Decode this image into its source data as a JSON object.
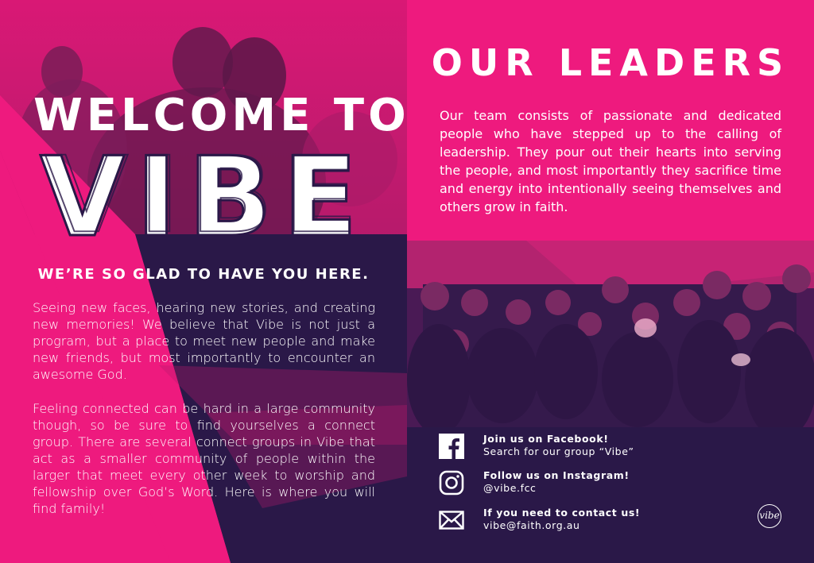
{
  "left": {
    "welcome": "WELCOME TO",
    "vibe": "VIBE",
    "subhead": "WE’RE SO GLAD TO HAVE YOU HERE.",
    "paragraph1": "Seeing new faces, hearing new stories, and creating new memories! We believe that Vibe is not just a program, but a place to meet new people and make new friends, but most importantly to encounter an awesome God.",
    "paragraph2": "Feeling connected can be hard in a large community though, so be sure to find yourselves a connect group. There are several connect groups in Vibe that act as a smaller community of people within the larger that meet every other week to worship and fellowship over God’s Word. Here is where you will find family!"
  },
  "right": {
    "title": "OUR LEADERS",
    "paragraph": "Our team consists of passionate and dedicated people who have stepped up to the calling of leadership. They pour out their hearts into serving the people, and most importantly they sacrifice time and energy into intentionally seeing themselves and others grow in faith.",
    "contacts": [
      {
        "icon": "facebook-icon",
        "heading": "Join us on Facebook!",
        "detail": "Search for our group “Vibe”"
      },
      {
        "icon": "instagram-icon",
        "heading": "Follow us on Instagram!",
        "detail": "@vibe.fcc"
      },
      {
        "icon": "mail-icon",
        "heading": "If you need to contact us!",
        "detail": "vibe@faith.org.au"
      }
    ],
    "logo": "vibe"
  },
  "colors": {
    "pink": "#ee1a7e",
    "navy": "#2a1848",
    "white": "#ffffff"
  }
}
